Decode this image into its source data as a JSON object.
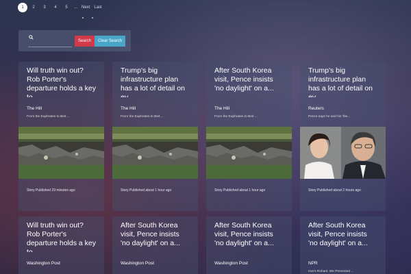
{
  "pagination": {
    "pages": [
      "1",
      "2",
      "3",
      "4",
      "5"
    ],
    "active": "1",
    "ellipsis": "...",
    "next": "Next",
    "last": "Last"
  },
  "search": {
    "placeholder": "",
    "value": "",
    "search_label": "Search",
    "clear_label": "Clear Search"
  },
  "cards": [
    {
      "title": "Will truth win out? Rob Porter's departure holds a key to...",
      "source": "The Hill",
      "snippet": "From the Euphrates to Beit ...",
      "image": "wreckage-photo",
      "time": "Story Published 29 minutes ago"
    },
    {
      "title": "Trump's big infrastructure plan has a lot of detail on ev...",
      "source": "The Hill",
      "snippet": "From the Euphrates to Beit ...",
      "image": "wreckage-photo",
      "time": "Story Published about 1 hour ago"
    },
    {
      "title": "After South Korea visit, Pence insists 'no daylight' on a...",
      "source": "The Hill",
      "snippet": "From the Euphrates to Beit ...",
      "image": "wreckage-photo",
      "time": "Story Published about 1 hour ago"
    },
    {
      "title": "Trump's big infrastructure plan has a lot of detail on ev...",
      "source": "Reuters",
      "snippet": "Pence says he and his 'frie...",
      "image": "people-photo",
      "time": "Story Published about 2 hours ago"
    },
    {
      "title": "Will truth win out? Rob Porter's departure holds a key to...",
      "source": "Washington Post",
      "snippet": "",
      "image": "",
      "time": ""
    },
    {
      "title": "After South Korea visit, Pence insists 'no daylight' on a...",
      "source": "Washington Post",
      "snippet": "",
      "image": "",
      "time": ""
    },
    {
      "title": "After South Korea visit, Pence insists 'no daylight' on a...",
      "source": "Washington Post",
      "snippet": "",
      "image": "",
      "time": ""
    },
    {
      "title": "After South Korea visit, Pence insists 'no daylight' on a...",
      "source": "NPR",
      "snippet": "Iran's Rohani: We Prevented ...",
      "image": "",
      "time": ""
    }
  ]
}
